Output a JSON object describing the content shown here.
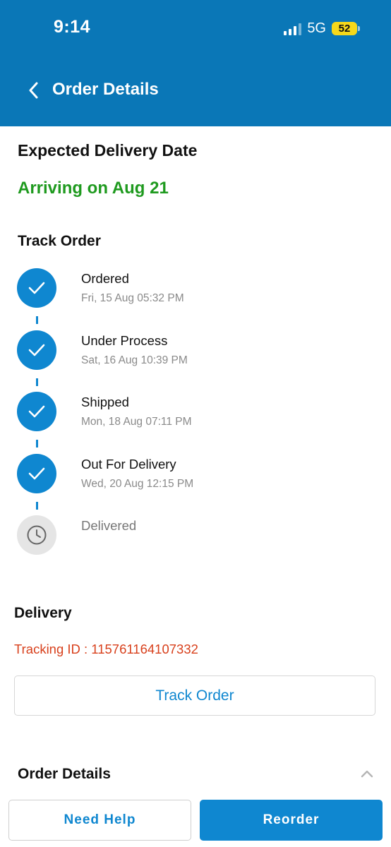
{
  "status_bar": {
    "time": "9:14",
    "network": "5G",
    "battery": "52"
  },
  "header": {
    "title": "Order Details",
    "back_icon": "chevron-left-icon"
  },
  "delivery_estimate": {
    "title": "Expected Delivery Date",
    "value": "Arriving on Aug 21"
  },
  "track": {
    "title": "Track Order",
    "steps": [
      {
        "label": "Ordered",
        "time": "Fri, 15 Aug 05:32 PM",
        "done": true,
        "icon": "check-icon"
      },
      {
        "label": "Under Process",
        "time": "Sat, 16 Aug 10:39 PM",
        "done": true,
        "icon": "check-icon"
      },
      {
        "label": "Shipped",
        "time": "Mon, 18 Aug 07:11 PM",
        "done": true,
        "icon": "check-icon"
      },
      {
        "label": "Out For Delivery",
        "time": "Wed, 20 Aug 12:15 PM",
        "done": true,
        "icon": "check-icon"
      },
      {
        "label": "Delivered",
        "time": "",
        "done": false,
        "icon": "clock-icon"
      }
    ]
  },
  "delivery": {
    "title": "Delivery",
    "tracking": "Tracking ID : 115761164107332",
    "track_button": "Track Order"
  },
  "order_details": {
    "title": "Order Details",
    "icon": "chevron-up-icon"
  },
  "actions": {
    "help_label": "Need Help",
    "reorder_label": "Reorder"
  },
  "colors": {
    "header": "#0a77b7",
    "accent": "#0f87d0",
    "success": "#1f9a1f",
    "tracking": "#d8401c"
  }
}
